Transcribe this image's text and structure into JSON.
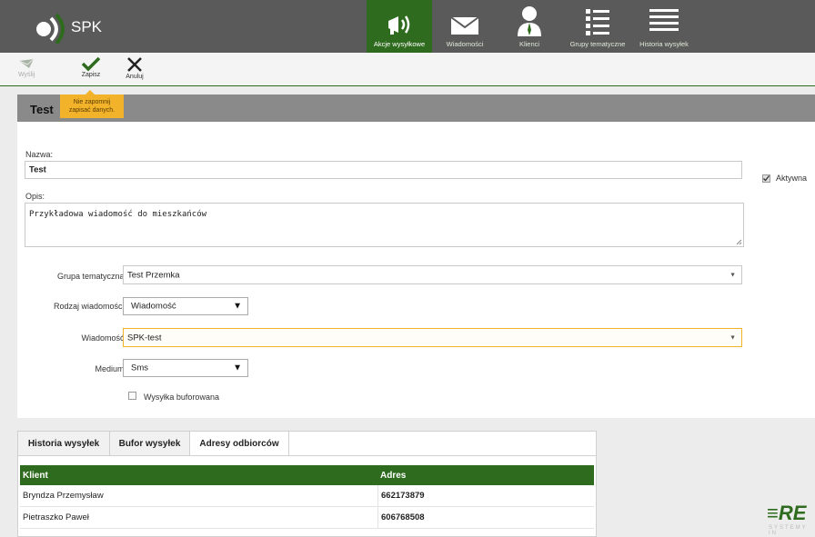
{
  "app": {
    "logo_text": "SPK",
    "brand_mark": "≡RE",
    "brand_sub": "SYSTEMY IN"
  },
  "nav": [
    {
      "label": "Akcje wysyłkowe",
      "icon": "megaphone-icon",
      "active": true
    },
    {
      "label": "Wiadomości",
      "icon": "envelope-icon",
      "active": false
    },
    {
      "label": "Klienci",
      "icon": "person-icon",
      "active": false
    },
    {
      "label": "Grupy tematyczne",
      "icon": "list-icon",
      "active": false
    },
    {
      "label": "Historia wysyłek",
      "icon": "lines-icon",
      "active": false
    }
  ],
  "toolbar": {
    "send_label": "Wyślij",
    "save_label": "Zapisz",
    "cancel_label": "Anuluj"
  },
  "tooltip": {
    "line1": "Nie zapomnij",
    "line2": "zapisać danych."
  },
  "form": {
    "title": "Test",
    "name_label": "Nazwa:",
    "name_value": "Test",
    "active_label": "Aktywna",
    "desc_label": "Opis:",
    "desc_value": "Przykładowa wiadomość do mieszkańców",
    "group_label": "Grupa tematyczna:",
    "group_value": "Test Przemka",
    "type_label": "Rodzaj wiadomości:",
    "type_value": "Wiadomość",
    "message_label": "Wiadomość:",
    "message_value": "SPK-test",
    "medium_label": "Medium:",
    "medium_value": "Sms",
    "buffered_label": "Wysyłka buforowana"
  },
  "tabs": [
    {
      "label": "Historia wysyłek",
      "active": false
    },
    {
      "label": "Bufor wysyłek",
      "active": false
    },
    {
      "label": "Adresy odbiorców",
      "active": true
    }
  ],
  "table": {
    "headers": [
      "Klient",
      "Adres"
    ],
    "rows": [
      {
        "client": "Bryndza Przemysław",
        "address": "662173879"
      },
      {
        "client": "Pietraszko Paweł",
        "address": "606768508"
      }
    ]
  },
  "colors": {
    "header_bg": "#5a5a5a",
    "accent": "#2f6b1e",
    "tooltip": "#f2b32b",
    "highlight_border": "#f2b32b"
  }
}
